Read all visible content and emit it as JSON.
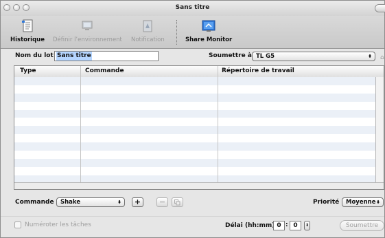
{
  "window": {
    "title": "Sans titre"
  },
  "toolbar": {
    "items": [
      {
        "label": "Historique",
        "icon": "history-icon",
        "enabled": true
      },
      {
        "label": "Définir l’environnement",
        "icon": "environment-icon",
        "enabled": false
      },
      {
        "label": "Notification",
        "icon": "notification-icon",
        "enabled": false
      },
      {
        "label": "Share Monitor",
        "icon": "share-monitor-icon",
        "enabled": true
      }
    ]
  },
  "batch": {
    "name_label": "Nom du lot :",
    "name_value": "Sans titre",
    "submit_to_label": "Soumettre à :",
    "submit_to_value": "TL G5"
  },
  "table": {
    "columns": [
      "Type",
      "Commande",
      "Répertoire de travail"
    ],
    "rows": []
  },
  "command": {
    "label": "Commande :",
    "value": "Shake",
    "add_label": "+",
    "remove_label": "−"
  },
  "priority": {
    "label": "Priorité :",
    "value": "Moyenne"
  },
  "footer": {
    "numbering_label": "Numéroter les tâches",
    "delay_label": "Délai (hh:mm) :",
    "delay_hours": "0",
    "delay_separator": ":",
    "delay_minutes": "0",
    "submit_label": "Soumettre"
  },
  "colors": {
    "selection": "#b5d5ff",
    "row_stripe": "#ebf0f7",
    "icon_blue": "#2f78d8"
  }
}
